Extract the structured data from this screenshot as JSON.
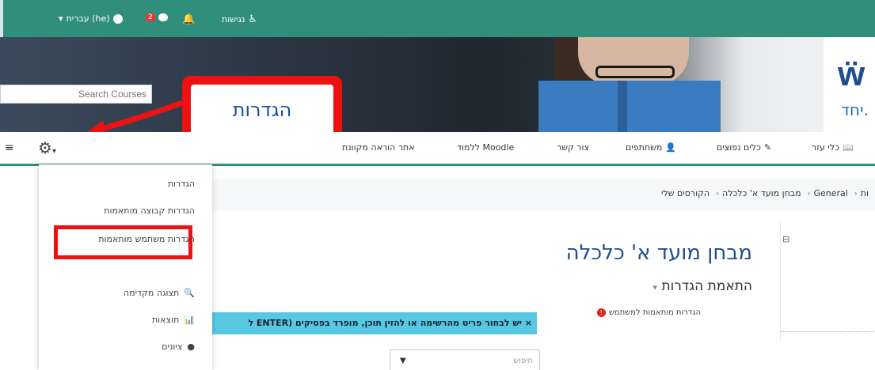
{
  "topbar": {
    "language_label": "עברית (he)",
    "messages_badge": "2",
    "accessibility_label": "נגישות"
  },
  "banner": {
    "search_placeholder": "Search Courses",
    "logo_subtitle": "יחד."
  },
  "callout": {
    "text": "הגדרות"
  },
  "nav": {
    "items": [
      {
        "label": "כלי עזר"
      },
      {
        "label": "כלים נפוצים"
      },
      {
        "label": "משתתפים"
      },
      {
        "label": "צור קשר"
      },
      {
        "label": "ללמוד Moodle"
      },
      {
        "label": "אתר הוראה מקוונת"
      }
    ]
  },
  "breadcrumb": {
    "items": [
      "ות",
      "General",
      "מבחן מועד א' כלכלה",
      "הקורסים שלי"
    ]
  },
  "dropdown": {
    "items": [
      {
        "label": "הגדרות"
      },
      {
        "label": "הגדרות קבוצה מותאמות"
      },
      {
        "label": "הגדרות משתמש מותאמות"
      },
      {
        "label": "תצוגה מקדימה"
      },
      {
        "label": "תוצאות"
      },
      {
        "label": "ציונים"
      }
    ]
  },
  "page": {
    "title": "מבחן מועד א' כלכלה",
    "section": "התאמת הגדרות",
    "note": "הגדרות מותאמות למשתמש",
    "info_bar": "× יש לבחור פריט מהרשימה או להזין תוכן, מופרד בפסיקים (ENTER ל",
    "search_placeholder": "חיפוש"
  }
}
